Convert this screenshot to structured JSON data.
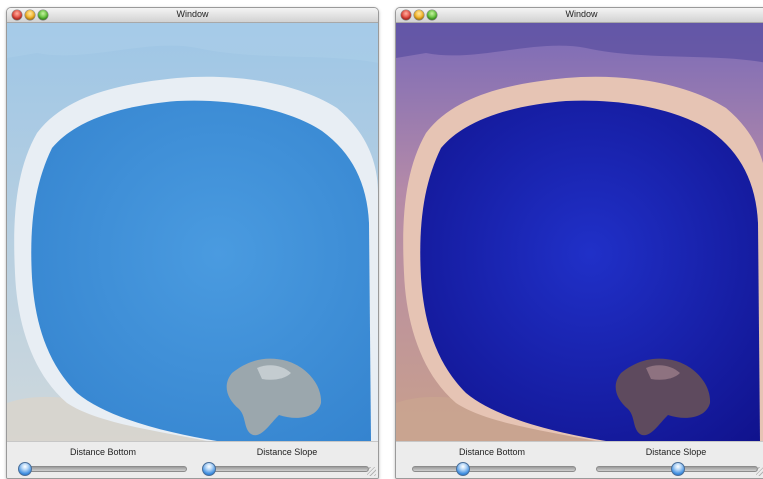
{
  "windows": [
    {
      "title": "Window",
      "sliders": [
        {
          "label": "Distance Bottom",
          "value": 0.0
        },
        {
          "label": "Distance Slope",
          "value": 0.0
        }
      ]
    },
    {
      "title": "Window",
      "sliders": [
        {
          "label": "Distance Bottom",
          "value": 0.3
        },
        {
          "label": "Distance Slope",
          "value": 0.5
        }
      ]
    }
  ],
  "colors": {
    "left_lake": "#3a8fd8",
    "right_lake": "#1a1fb8",
    "left_rim": "#e4ecf4",
    "right_rim": "#e8c9b8"
  }
}
